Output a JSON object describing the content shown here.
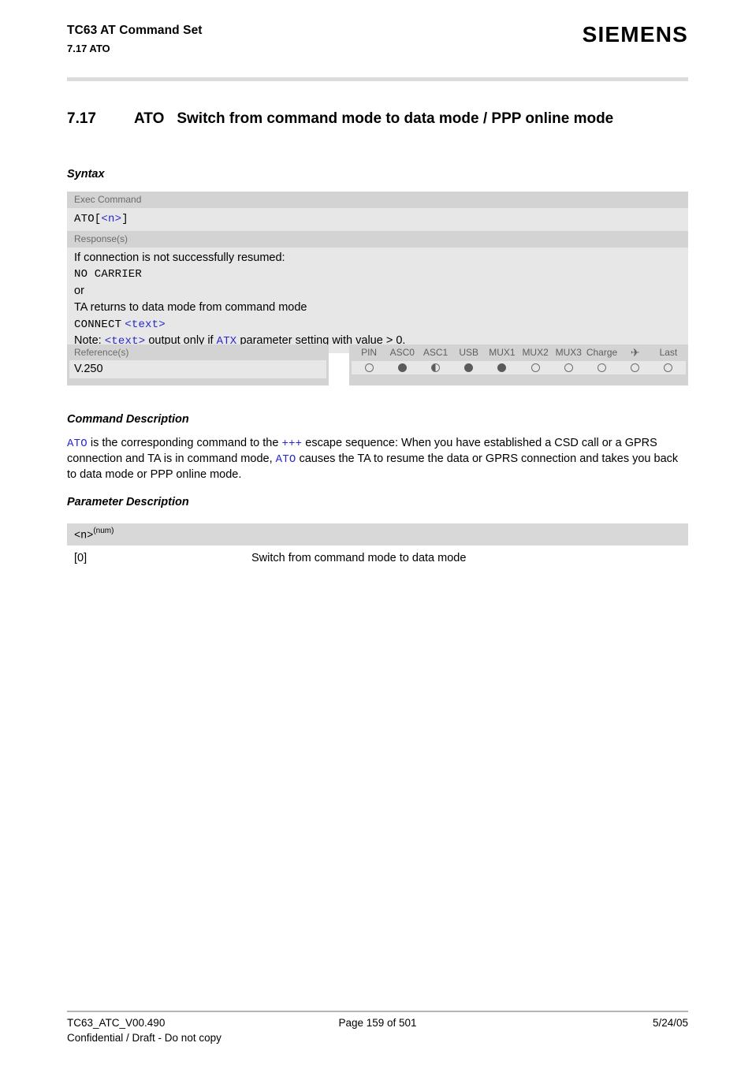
{
  "header": {
    "title": "TC63 AT Command Set",
    "subtitle": "7.17 ATO",
    "brand": "SIEMENS"
  },
  "section": {
    "number": "7.17",
    "command": "ATO",
    "title": "Switch from command mode to data mode / PPP online mode"
  },
  "syntax": {
    "heading": "Syntax",
    "exec_label": "Exec Command",
    "exec_command_prefix": "ATO[",
    "exec_command_param": "<n>",
    "exec_command_suffix": "]",
    "response_label": "Response(s)",
    "response_line1": "If connection is not successfully resumed:",
    "response_line2": "NO CARRIER",
    "response_line3": "or",
    "response_line4": "TA returns to data mode from command mode",
    "response_line5_code": "CONNECT",
    "response_line5_param": "<text>",
    "note_prefix": "Note:",
    "note_param": "<text>",
    "note_mid": "output only if",
    "note_cmd": "ATX",
    "note_suffix": "parameter setting with value > 0."
  },
  "reference": {
    "label": "Reference(s)",
    "value": "V.250"
  },
  "ports": {
    "columns": [
      {
        "label": "PIN",
        "state": "empty"
      },
      {
        "label": "ASC0",
        "state": "full"
      },
      {
        "label": "ASC1",
        "state": "half"
      },
      {
        "label": "USB",
        "state": "full"
      },
      {
        "label": "MUX1",
        "state": "full"
      },
      {
        "label": "MUX2",
        "state": "empty"
      },
      {
        "label": "MUX3",
        "state": "empty"
      },
      {
        "label": "Charge",
        "state": "empty"
      },
      {
        "label": "✈",
        "state": "empty",
        "is_icon": true
      },
      {
        "label": "Last",
        "state": "empty"
      }
    ]
  },
  "command_description": {
    "heading": "Command Description",
    "code1": "ATO",
    "text1": " is the corresponding command to the ",
    "code2": "+++",
    "text2": " escape sequence: When you have established a CSD call or a GPRS connection and TA is in command mode, ",
    "code3": "ATO",
    "text3": " causes the TA to resume the data or GPRS connection and takes you back to data mode or PPP online mode."
  },
  "parameter_description": {
    "heading": "Parameter Description",
    "param_name": "<n>",
    "param_type": "(num)",
    "rows": [
      {
        "key": "[0]",
        "desc": "Switch from command mode to data mode"
      }
    ]
  },
  "footer": {
    "doc_id": "TC63_ATC_V00.490",
    "page": "Page 159 of 501",
    "date": "5/24/05",
    "confidential": "Confidential / Draft - Do not copy"
  },
  "colors": {
    "code_blue": "#2727cf",
    "label_bg": "#d3d3d3",
    "content_bg": "#e7e7e7",
    "rule": "#dcdcdc"
  }
}
